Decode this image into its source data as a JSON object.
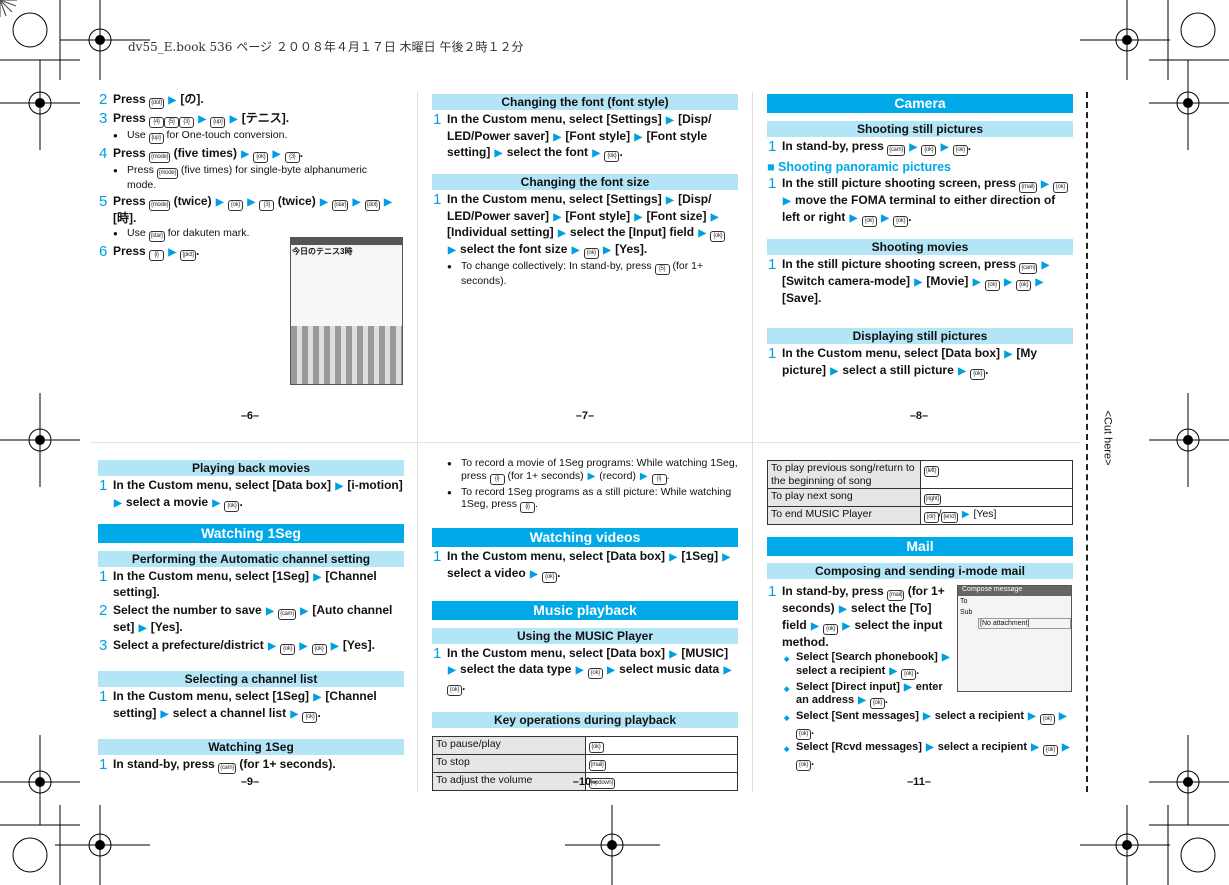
{
  "header_line": "dv55_E.book  536 ページ  ２００８年４月１７日  木曜日  午後２時１２分",
  "cut_label": "<Cut here>",
  "colors": {
    "main_header": "#00a9e8",
    "sub_header": "#b3e5f7",
    "accent": "#00a0e0"
  },
  "page_numbers": [
    "–6–",
    "–7–",
    "–8–",
    "–9–",
    "–10–",
    "–11–"
  ],
  "p6": {
    "steps": [
      {
        "num": "2",
        "text": "Press {dot} ▶ [の]."
      },
      {
        "num": "3",
        "text": "Press {4}{5}{3} ▶ {up} ▶ [テニス]."
      },
      {
        "num": "4",
        "text": "Press {mode} (five times) ▶ {ok} ▶ {3}."
      },
      {
        "num": "5",
        "text": "Press {mode} (twice) ▶ {ok} ▶ {3} (twice) ▶ {star} ▶ {dot} ▶ [時]."
      },
      {
        "num": "6",
        "text": "Press {i} ▶ {pict}."
      }
    ],
    "notes": [
      "Use {up} for One-touch conversion.",
      "Press {mode} (five times) for single-byte alphanumeric mode.",
      "Use {star} for dakuten mark."
    ],
    "screen_text": "今日のテニス3時"
  },
  "p7": {
    "sec1": {
      "title": "Changing the font (font style)",
      "step": "In the Custom menu, select [Settings] ▶ [Disp/ LED/Power saver] ▶ [Font style] ▶ [Font style setting] ▶ select the font ▶ {ok}."
    },
    "sec2": {
      "title": "Changing the font size",
      "step": "In the Custom menu, select [Settings] ▶ [Disp/ LED/Power saver] ▶ [Font style] ▶ [Font size] ▶ [Individual setting] ▶ select the [Input] field ▶ {ok} ▶ select the font size ▶ {ok} ▶ [Yes].",
      "note": "To change collectively: In stand-by, press {5} (for 1+ seconds)."
    }
  },
  "p8": {
    "title": "Camera",
    "sec1": {
      "title": "Shooting still pictures",
      "step": "In stand-by, press {cam} ▶ {ok} ▶ {ok}.",
      "subtitle": "Shooting panoramic pictures",
      "step2": "In the still picture shooting screen, press {mail} ▶ {ok} ▶ move the FOMA terminal to either direction of left or right ▶ {ok} ▶ {ok}."
    },
    "sec2": {
      "title": "Shooting movies",
      "step": "In the still picture shooting screen, press {cam} ▶ [Switch camera-mode] ▶ [Movie] ▶ {ok} ▶ {ok} ▶ [Save]."
    },
    "sec3": {
      "title": "Displaying still pictures",
      "step": "In the Custom menu, select [Data box] ▶ [My picture] ▶ select a still picture ▶ {ok}."
    }
  },
  "p9": {
    "sec1": {
      "title": "Playing back movies",
      "step": "In the Custom menu, select [Data box] ▶ [i-motion] ▶ select a movie ▶ {ok}."
    },
    "title": "Watching 1Seg",
    "sec2": {
      "title": "Performing the Automatic channel setting",
      "steps": [
        {
          "num": "1",
          "text": "In the Custom menu, select [1Seg] ▶ [Channel setting]."
        },
        {
          "num": "2",
          "text": "Select the number to save ▶ {cam} ▶ [Auto channel set] ▶ [Yes]."
        },
        {
          "num": "3",
          "text": "Select a prefecture/district ▶ {ok} ▶ {ok} ▶ [Yes]."
        }
      ]
    },
    "sec3": {
      "title": "Selecting a channel list",
      "step": "In the Custom menu, select [1Seg] ▶ [Channel setting] ▶ select a channel list ▶ {ok}."
    },
    "sec4": {
      "title": "Watching 1Seg",
      "step": "In stand-by, press {cam} (for 1+ seconds)."
    }
  },
  "p10": {
    "notes": [
      "To record a movie of 1Seg programs: While watching 1Seg, press {i} (for 1+ seconds) ▶ (record) ▶ {i}.",
      "To record 1Seg programs as a still picture: While watching 1Seg, press {i}."
    ],
    "title1": "Watching videos",
    "step1": "In the Custom menu, select [Data box] ▶ [1Seg] ▶ select a video ▶ {ok}.",
    "title2": "Music playback",
    "sec1": {
      "title": "Using the MUSIC Player",
      "step": "In the Custom menu, select [Data box] ▶ [MUSIC] ▶ select the data type ▶ {ok} ▶ select music data ▶ {ok}."
    },
    "sec2": {
      "title": "Key operations during playback"
    },
    "table": [
      {
        "op": "To pause/play",
        "key": "{ok}"
      },
      {
        "op": "To stop",
        "key": "{mail}"
      },
      {
        "op": "To adjust the volume",
        "key": "{updown}"
      }
    ]
  },
  "p11": {
    "table": [
      {
        "op": "To play previous song/return to the beginning of song",
        "key": "{left}"
      },
      {
        "op": "To play next song",
        "key": "{right}"
      },
      {
        "op": "To end MUSIC Player",
        "key": "{clr}/{end} ▶ [Yes]"
      }
    ],
    "title": "Mail",
    "sec1": {
      "title": "Composing and sending i-mode mail",
      "step": "In stand-by, press {mail} (for 1+ seconds) ▶ select the [To] field ▶ {ok} ▶ select the input method."
    },
    "options": [
      "Select [Search phonebook] ▶ select a recipient ▶ {ok}.",
      "Select [Direct input] ▶ enter an address ▶ {ok}.",
      "Select [Sent messages] ▶ select a recipient ▶ {ok} ▶ {ok}.",
      "Select [Rcvd messages] ▶ select a recipient ▶ {ok} ▶ {ok}."
    ],
    "screen": {
      "title": "Compose message",
      "to": "To",
      "subj": "Sub",
      "attach": "[No attachment]"
    }
  }
}
